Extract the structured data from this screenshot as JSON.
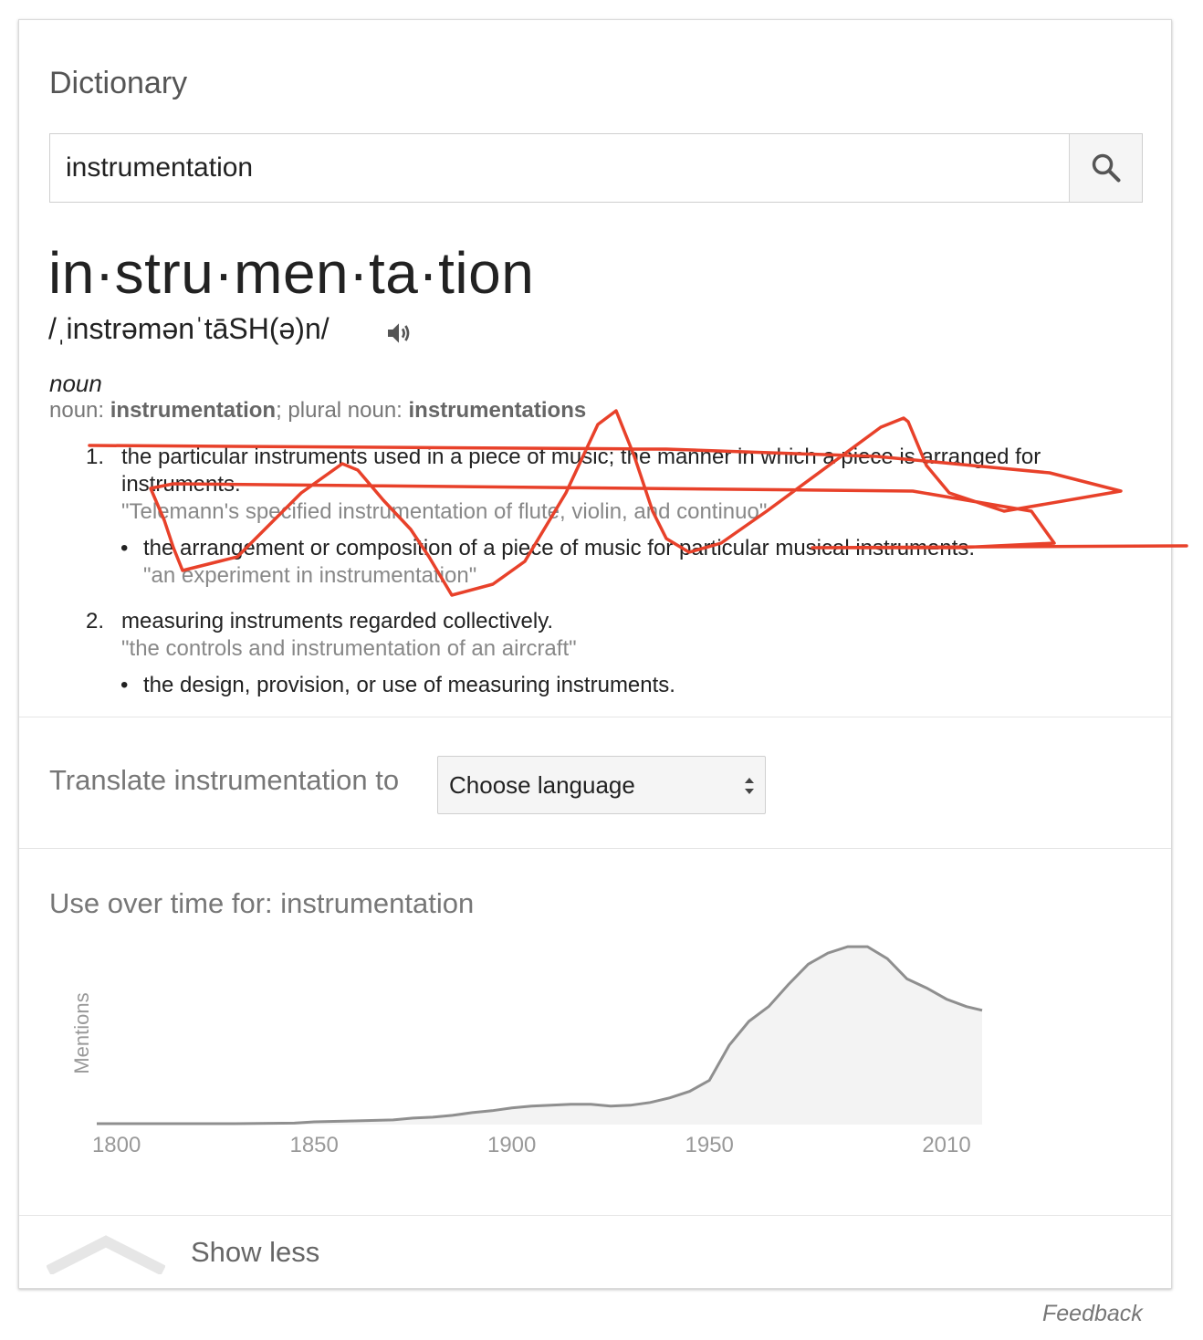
{
  "card": {
    "title": "Dictionary",
    "search": {
      "value": "instrumentation",
      "icon": "search-icon"
    },
    "headword": "in·stru·men·ta·tion",
    "phonetic": "/ˌinstrəmənˈtāSH(ə)n/",
    "part_of_speech": "noun",
    "forms": {
      "noun_label": "noun: ",
      "noun": "instrumentation",
      "sep": "; ",
      "plural_label": "plural noun: ",
      "plural": "instrumentations"
    },
    "senses": [
      {
        "num": "1.",
        "def_line1": "the particular instruments used in a piece of music; the manner in which a piece is arranged for",
        "def_line2": "instruments.",
        "example": "\"Telemann's specified instrumentation of flute, violin, and continuo\"",
        "sub": {
          "bullet": "•",
          "def": "the arrangement or composition of a piece of music for particular musical instruments.",
          "example": "\"an experiment in instrumentation\""
        }
      },
      {
        "num": "2.",
        "def": "measuring instruments regarded collectively.",
        "example": "\"the controls and instrumentation of an aircraft\"",
        "sub": {
          "bullet": "•",
          "def": "the design, provision, or use of measuring instruments."
        }
      }
    ],
    "translate": {
      "label": "Translate instrumentation to",
      "select_value": "Choose language"
    },
    "usage": {
      "title": "Use over time for: instrumentation"
    },
    "show_less": "Show less"
  },
  "feedback": "Feedback",
  "colors": {
    "annotation": "#e8412a",
    "chart_fill": "#f3f3f3",
    "chart_line": "#8f8f8f"
  },
  "chart_data": {
    "type": "area",
    "title": "Use over time for: instrumentation",
    "xlabel": "",
    "ylabel": "Mentions",
    "xlim": [
      1795,
      2019
    ],
    "ylim": [
      0,
      100
    ],
    "grid": false,
    "x_ticks": [
      "1800",
      "1850",
      "1900",
      "1950",
      "2010"
    ],
    "x": [
      1795,
      1810,
      1830,
      1845,
      1850,
      1860,
      1870,
      1875,
      1880,
      1885,
      1890,
      1895,
      1900,
      1905,
      1910,
      1915,
      1920,
      1925,
      1930,
      1935,
      1940,
      1945,
      1950,
      1955,
      1960,
      1965,
      1970,
      1975,
      1980,
      1985,
      1990,
      1995,
      2000,
      2005,
      2010,
      2015,
      2019
    ],
    "values": [
      0.5,
      0.5,
      0.5,
      0.8,
      1.5,
      2.0,
      2.5,
      3.5,
      4.0,
      5.0,
      6.5,
      7.5,
      9.0,
      10.0,
      10.5,
      11.0,
      11.0,
      10.0,
      10.5,
      12.0,
      14.5,
      18.0,
      24.0,
      43.0,
      56.0,
      64.0,
      76.0,
      87.0,
      93.0,
      96.5,
      96.5,
      90.0,
      79.0,
      74.0,
      68.0,
      64.0,
      62.0
    ]
  }
}
